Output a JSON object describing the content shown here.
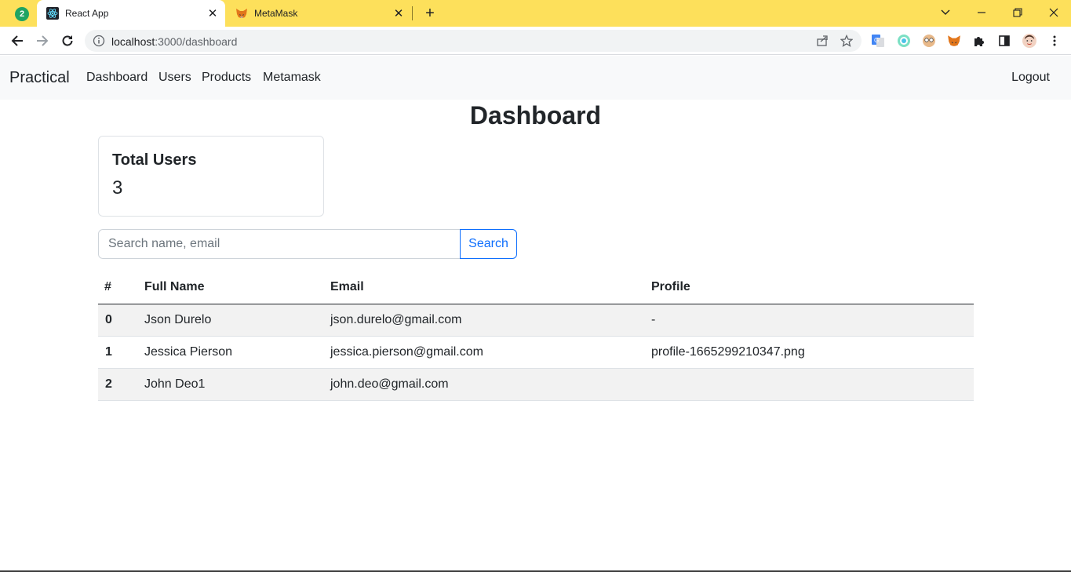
{
  "browser": {
    "tab_group_count": "2",
    "tabs": [
      {
        "title": "React App",
        "icon": "react-icon"
      },
      {
        "title": "MetaMask",
        "icon": "metamask-fox-icon"
      }
    ],
    "new_tab_symbol": "+",
    "url_host": "localhost",
    "url_rest": ":3000/dashboard",
    "accent_color": "#fde05b"
  },
  "navbar": {
    "brand": "Practical",
    "links": [
      "Dashboard",
      "Users",
      "Products",
      "Metamask"
    ],
    "logout": "Logout"
  },
  "page": {
    "title": "Dashboard"
  },
  "stats": {
    "label": "Total Users",
    "value": "3"
  },
  "search": {
    "placeholder": "Search name, email",
    "button_label": "Search",
    "button_color": "#0d6efd"
  },
  "table": {
    "headers": [
      "#",
      "Full Name",
      "Email",
      "Profile"
    ],
    "rows": [
      {
        "idx": "0",
        "name": "Json Durelo",
        "email": "json.durelo@gmail.com",
        "profile": "-"
      },
      {
        "idx": "1",
        "name": "Jessica Pierson",
        "email": "jessica.pierson@gmail.com",
        "profile": "profile-1665299210347.png"
      },
      {
        "idx": "2",
        "name": "John Deo1",
        "email": "john.deo@gmail.com",
        "profile": ""
      }
    ]
  }
}
